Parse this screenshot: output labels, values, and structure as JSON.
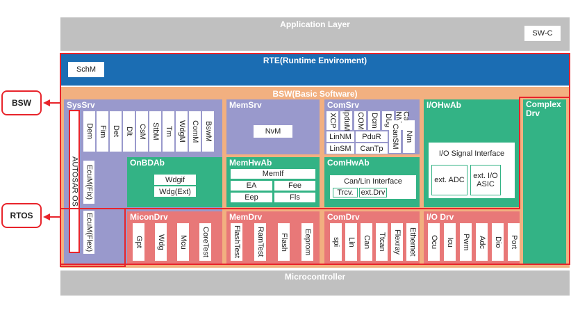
{
  "application_layer": {
    "title": "Application Layer",
    "swc": "SW-C"
  },
  "rte": {
    "title": "RTE(Runtime Enviroment)",
    "schm": "SchM"
  },
  "bsw": {
    "title": "BSW(Basic Software)"
  },
  "syssrv": {
    "title": "SysSrv",
    "items": [
      "Dem",
      "Fim",
      "Det",
      "Dlt",
      "CsM",
      "StbM",
      "Tm",
      "WdgM",
      "ComM",
      "BswM"
    ],
    "ecum_fix": "EcuM(Fix)",
    "ecum_flex": "EcuM(Flex)",
    "os": "AUTOSAR OS"
  },
  "memsrv": {
    "title": "MemSrv",
    "nvm": "NvM"
  },
  "comsrv": {
    "title": "ComSrv",
    "items": [
      "XCP",
      "IpduM",
      "COM",
      "Dcm",
      "Dbg",
      "Can NM"
    ],
    "linnm": "LinNM",
    "pdur": "PduR",
    "linsm": "LinSM",
    "cantp": "CanTp",
    "cansm": "CanSM",
    "nm": "Nm"
  },
  "iohwab": {
    "title": "I/OHwAb",
    "signal": "I/O Signal Interface",
    "ext_adc": "ext. ADC",
    "ext_asic": "ext. I/O ASIC"
  },
  "complex": {
    "title": "Complex Drv"
  },
  "onbdab": {
    "title": "OnBDAb",
    "wdgif": "Wdgif",
    "wdgext": "Wdg(Ext)"
  },
  "memhwab": {
    "title": "MemHwAb",
    "memif": "MemIf",
    "ea": "EA",
    "fee": "Fee",
    "eep": "Eep",
    "fls": "Fls"
  },
  "comhwab": {
    "title": "ComHwAb",
    "canlin": "Can/Lin Interface",
    "trcv": "Trcv.",
    "extdrv": "ext.Drv"
  },
  "micondrv": {
    "title": "MiconDrv",
    "items": [
      "Gpt",
      "Wdg",
      "Mcu",
      "CoreTest"
    ]
  },
  "memdrv": {
    "title": "MemDrv",
    "items": [
      "FlashTest",
      "RamTest",
      "Flash",
      "Eeprom"
    ]
  },
  "comdrv": {
    "title": "ComDrv",
    "items": [
      "spi",
      "Lin",
      "Can",
      "Ttcan",
      "Flexray",
      "Ethernet"
    ]
  },
  "iodrv": {
    "title": "I/O Drv",
    "items": [
      "Ocu",
      "Icu",
      "Pwm",
      "Adc",
      "Dio",
      "Port"
    ]
  },
  "microcontroller": {
    "title": "Microcontroller"
  },
  "callouts": {
    "bsw": "BSW",
    "rtos": "RTOS"
  },
  "colors": {
    "gray": "#c0c0c0",
    "blue": "#1b6db3",
    "orange": "#f2b080",
    "purple": "#9999cc",
    "green": "#33b385",
    "red": "#e87878",
    "callout": "#e8242b"
  }
}
